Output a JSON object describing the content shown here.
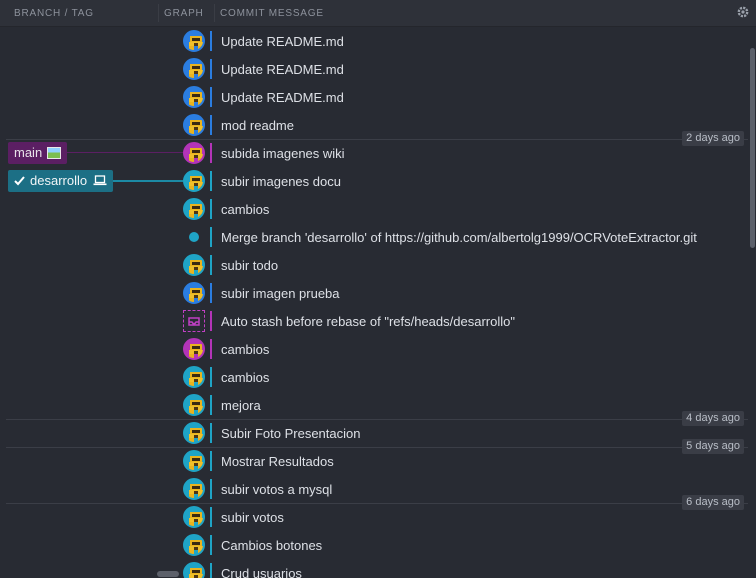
{
  "header": {
    "branch_tag": "BRANCH / TAG",
    "graph": "GRAPH",
    "commit_message": "COMMIT MESSAGE",
    "settings_icon": "gear-icon"
  },
  "colors": {
    "blue_lane": "#2b7de0",
    "teal_lane": "#1fa4c6",
    "purple_lane": "#b334b8",
    "main_tag": "#5b1f63",
    "dev_tag": "#1c6f85"
  },
  "branches": {
    "main": "main",
    "desarrollo": "desarrollo"
  },
  "commits": [
    {
      "message": "Update README.md",
      "lane": "blue",
      "node": "avatar",
      "date": ""
    },
    {
      "message": "Update README.md",
      "lane": "blue",
      "node": "avatar",
      "date": ""
    },
    {
      "message": "Update README.md",
      "lane": "blue",
      "node": "avatar",
      "date": ""
    },
    {
      "message": "mod readme",
      "lane": "blue",
      "node": "avatar",
      "date": ""
    },
    {
      "message": "subida imagenes wiki",
      "lane": "purple",
      "node": "avatar",
      "date": "2 days ago"
    },
    {
      "message": "subir imagenes docu",
      "lane": "teal",
      "node": "avatar",
      "date": ""
    },
    {
      "message": "cambios",
      "lane": "teal",
      "node": "avatar",
      "date": ""
    },
    {
      "message": "Merge branch 'desarrollo' of https://github.com/albertolg1999/OCRVoteExtractor.git",
      "lane": "teal",
      "node": "merge",
      "date": ""
    },
    {
      "message": "subir todo",
      "lane": "teal",
      "node": "avatar",
      "date": ""
    },
    {
      "message": "subir imagen prueba",
      "lane": "blue",
      "node": "avatar",
      "date": ""
    },
    {
      "message": "Auto stash before rebase of \"refs/heads/desarrollo\"",
      "lane": "purple",
      "node": "stash",
      "date": ""
    },
    {
      "message": "cambios",
      "lane": "purple",
      "node": "avatar",
      "date": ""
    },
    {
      "message": "cambios",
      "lane": "teal",
      "node": "avatar",
      "date": ""
    },
    {
      "message": "mejora",
      "lane": "teal",
      "node": "avatar",
      "date": ""
    },
    {
      "message": "Subir Foto Presentacion",
      "lane": "teal",
      "node": "avatar",
      "date": "4 days ago"
    },
    {
      "message": "Mostrar Resultados",
      "lane": "teal",
      "node": "avatar",
      "date": "5 days ago"
    },
    {
      "message": "subir votos a mysql",
      "lane": "teal",
      "node": "avatar",
      "date": ""
    },
    {
      "message": "subir votos",
      "lane": "teal",
      "node": "avatar",
      "date": "6 days ago"
    },
    {
      "message": "Cambios botones",
      "lane": "teal",
      "node": "avatar",
      "date": ""
    },
    {
      "message": "Crud usuarios",
      "lane": "teal",
      "node": "avatar",
      "date": ""
    }
  ]
}
